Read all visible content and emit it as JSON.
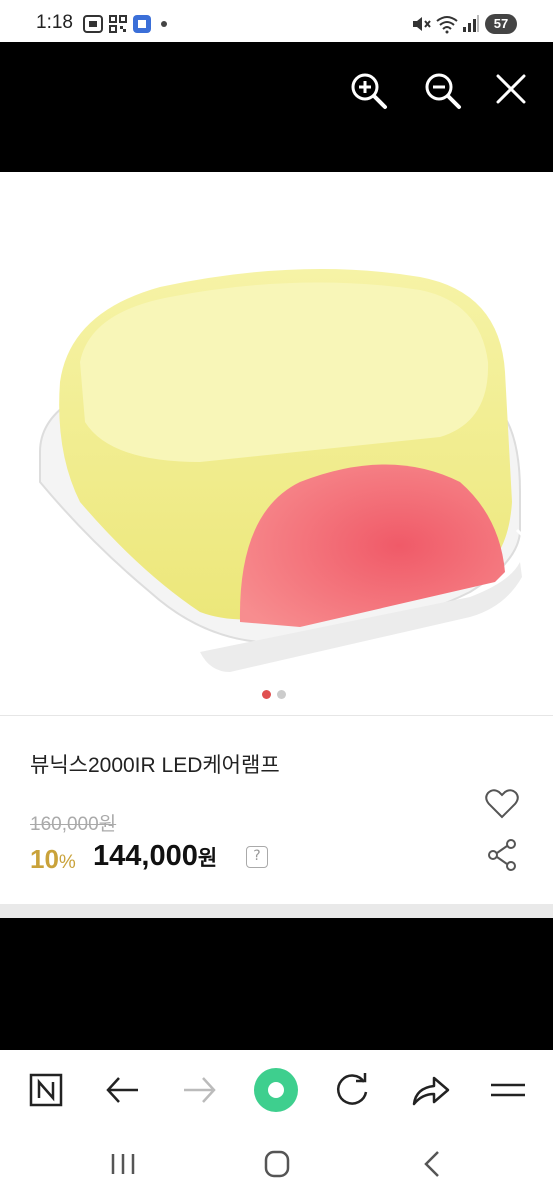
{
  "status_bar": {
    "time": "1:18",
    "battery": "57",
    "icons": [
      "screenshot-icon",
      "qr-icon",
      "app-badge-icon",
      "dot-icon",
      "mute-icon",
      "wifi-icon",
      "signal-icon"
    ]
  },
  "viewer": {
    "zoom_in_icon": "zoom-in-icon",
    "zoom_out_icon": "zoom-out-icon",
    "close_icon": "close-icon"
  },
  "product": {
    "title": "뷰닉스2000IR LED케어램프",
    "original_price": "160,000원",
    "discount_number": "10",
    "discount_symbol": "%",
    "price_number": "144,000",
    "price_unit": "원",
    "help_glyph": "?",
    "image_slide_count": 2,
    "image_active_slide": 1
  },
  "browser_toolbar": {
    "items": [
      "naver-icon",
      "back-icon",
      "forward-icon",
      "home-circle-icon",
      "refresh-icon",
      "share-icon",
      "menu-icon"
    ],
    "accent_color": "#3ecf8e"
  },
  "system_nav": {
    "items": [
      "recent-apps-icon",
      "home-icon",
      "back-icon"
    ]
  }
}
